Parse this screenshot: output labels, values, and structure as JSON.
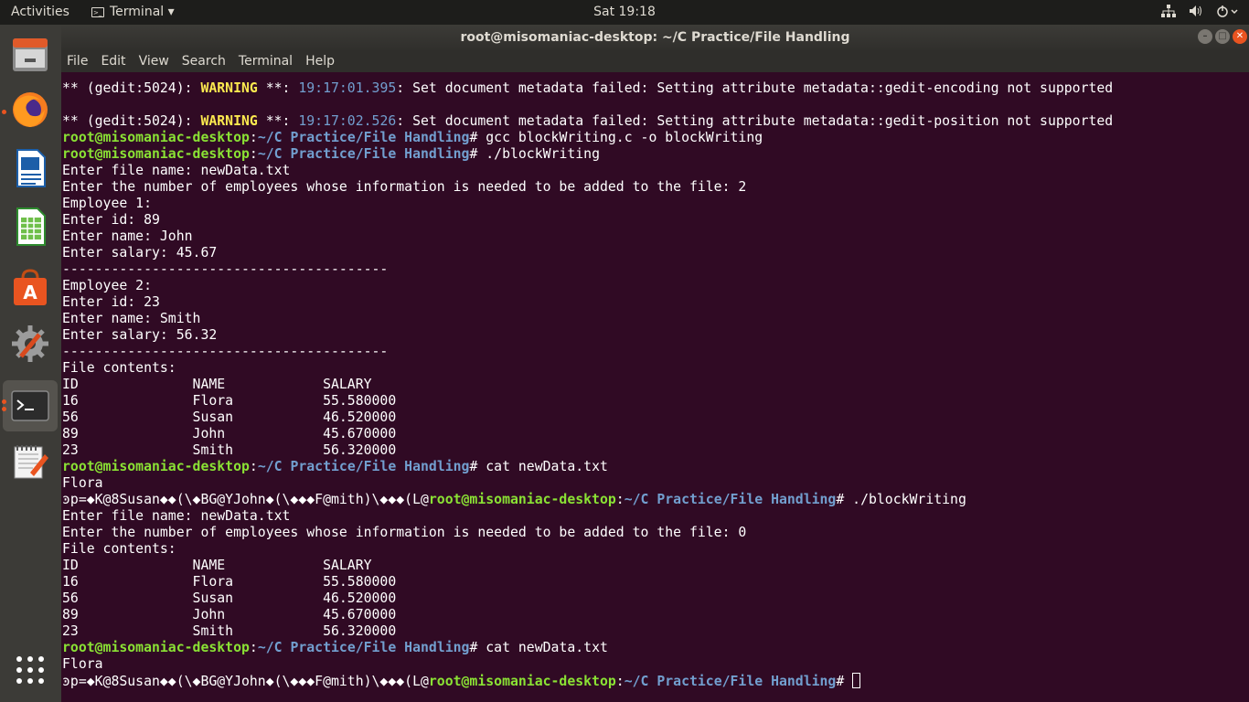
{
  "topbar": {
    "activities": "Activities",
    "app_name": "Terminal ▾",
    "clock": "Sat 19:18",
    "tray": [
      "network-icon",
      "volume-icon",
      "power-icon"
    ]
  },
  "dock": [
    "files-icon",
    "firefox-icon",
    "writer-icon",
    "calc-icon",
    "software-center-icon",
    "settings-icon",
    "terminal-icon",
    "text-editor-icon",
    "show-apps-icon"
  ],
  "window": {
    "title": "root@misomaniac-desktop: ~/C Practice/File Handling",
    "menu": [
      "File",
      "Edit",
      "View",
      "Search",
      "Terminal",
      "Help"
    ]
  },
  "terminal": {
    "lines": [
      [
        {
          "t": "** (gedit:5024): "
        },
        {
          "t": "WARNING",
          "c": "yl"
        },
        {
          "t": " **: "
        },
        {
          "t": "19:17:01.395",
          "c": "ts"
        },
        {
          "t": ": Set document metadata failed: Setting attribute metadata::gedit-encoding not supported"
        }
      ],
      [],
      [
        {
          "t": "** (gedit:5024): "
        },
        {
          "t": "WARNING",
          "c": "yl"
        },
        {
          "t": " **: "
        },
        {
          "t": "19:17:02.526",
          "c": "ts"
        },
        {
          "t": ": Set document metadata failed: Setting attribute metadata::gedit-position not supported"
        }
      ],
      [
        {
          "t": "root@misomaniac-desktop",
          "c": "gr"
        },
        {
          "t": ":"
        },
        {
          "t": "~/C Practice/File Handling",
          "c": "bl"
        },
        {
          "t": "# gcc blockWriting.c -o blockWriting"
        }
      ],
      [
        {
          "t": "root@misomaniac-desktop",
          "c": "gr"
        },
        {
          "t": ":"
        },
        {
          "t": "~/C Practice/File Handling",
          "c": "bl"
        },
        {
          "t": "# ./blockWriting"
        }
      ],
      [
        {
          "t": "Enter file name: newData.txt"
        }
      ],
      [
        {
          "t": "Enter the number of employees whose information is needed to be added to the file: 2"
        }
      ],
      [
        {
          "t": "Employee 1:"
        }
      ],
      [
        {
          "t": "Enter id: 89"
        }
      ],
      [
        {
          "t": "Enter name: John"
        }
      ],
      [
        {
          "t": "Enter salary: 45.67"
        }
      ],
      [
        {
          "t": "----------------------------------------"
        }
      ],
      [
        {
          "t": "Employee 2:"
        }
      ],
      [
        {
          "t": "Enter id: 23"
        }
      ],
      [
        {
          "t": "Enter name: Smith"
        }
      ],
      [
        {
          "t": "Enter salary: 56.32"
        }
      ],
      [
        {
          "t": "----------------------------------------"
        }
      ],
      [
        {
          "t": "File contents:"
        }
      ],
      [
        {
          "t": "ID              NAME            SALARY"
        }
      ],
      [
        {
          "t": "16              Flora           55.580000"
        }
      ],
      [
        {
          "t": "56              Susan           46.520000"
        }
      ],
      [
        {
          "t": "89              John            45.670000"
        }
      ],
      [
        {
          "t": "23              Smith           56.320000"
        }
      ],
      [
        {
          "t": "root@misomaniac-desktop",
          "c": "gr"
        },
        {
          "t": ":"
        },
        {
          "t": "~/C Practice/File Handling",
          "c": "bl"
        },
        {
          "t": "# cat newData.txt"
        }
      ],
      [
        {
          "t": "\u0010Flora"
        }
      ],
      [
        {
          "t": "ͽp=◆K@8Susan◆◆(\\◆BG@YJohn◆(\\◆◆◆F@\u0017mith)\\◆◆◆(L@"
        },
        {
          "t": "root@misomaniac-desktop",
          "c": "gr"
        },
        {
          "t": ":"
        },
        {
          "t": "~/C Practice/File Handling",
          "c": "bl"
        },
        {
          "t": "# ./blockWriting"
        }
      ],
      [
        {
          "t": "Enter file name: newData.txt"
        }
      ],
      [
        {
          "t": "Enter the number of employees whose information is needed to be added to the file: 0"
        }
      ],
      [
        {
          "t": "File contents:"
        }
      ],
      [
        {
          "t": "ID              NAME            SALARY"
        }
      ],
      [
        {
          "t": "16              Flora           55.580000"
        }
      ],
      [
        {
          "t": "56              Susan           46.520000"
        }
      ],
      [
        {
          "t": "89              John            45.670000"
        }
      ],
      [
        {
          "t": "23              Smith           56.320000"
        }
      ],
      [
        {
          "t": "root@misomaniac-desktop",
          "c": "gr"
        },
        {
          "t": ":"
        },
        {
          "t": "~/C Practice/File Handling",
          "c": "bl"
        },
        {
          "t": "# cat newData.txt"
        }
      ],
      [
        {
          "t": "\u0010Flora"
        }
      ],
      [
        {
          "t": "ͽp=◆K@8Susan◆◆(\\◆BG@YJohn◆(\\◆◆◆F@\u0017mith)\\◆◆◆(L@"
        },
        {
          "t": "root@misomaniac-desktop",
          "c": "gr"
        },
        {
          "t": ":"
        },
        {
          "t": "~/C Practice/File Handling",
          "c": "bl"
        },
        {
          "t": "# "
        }
      ]
    ]
  }
}
